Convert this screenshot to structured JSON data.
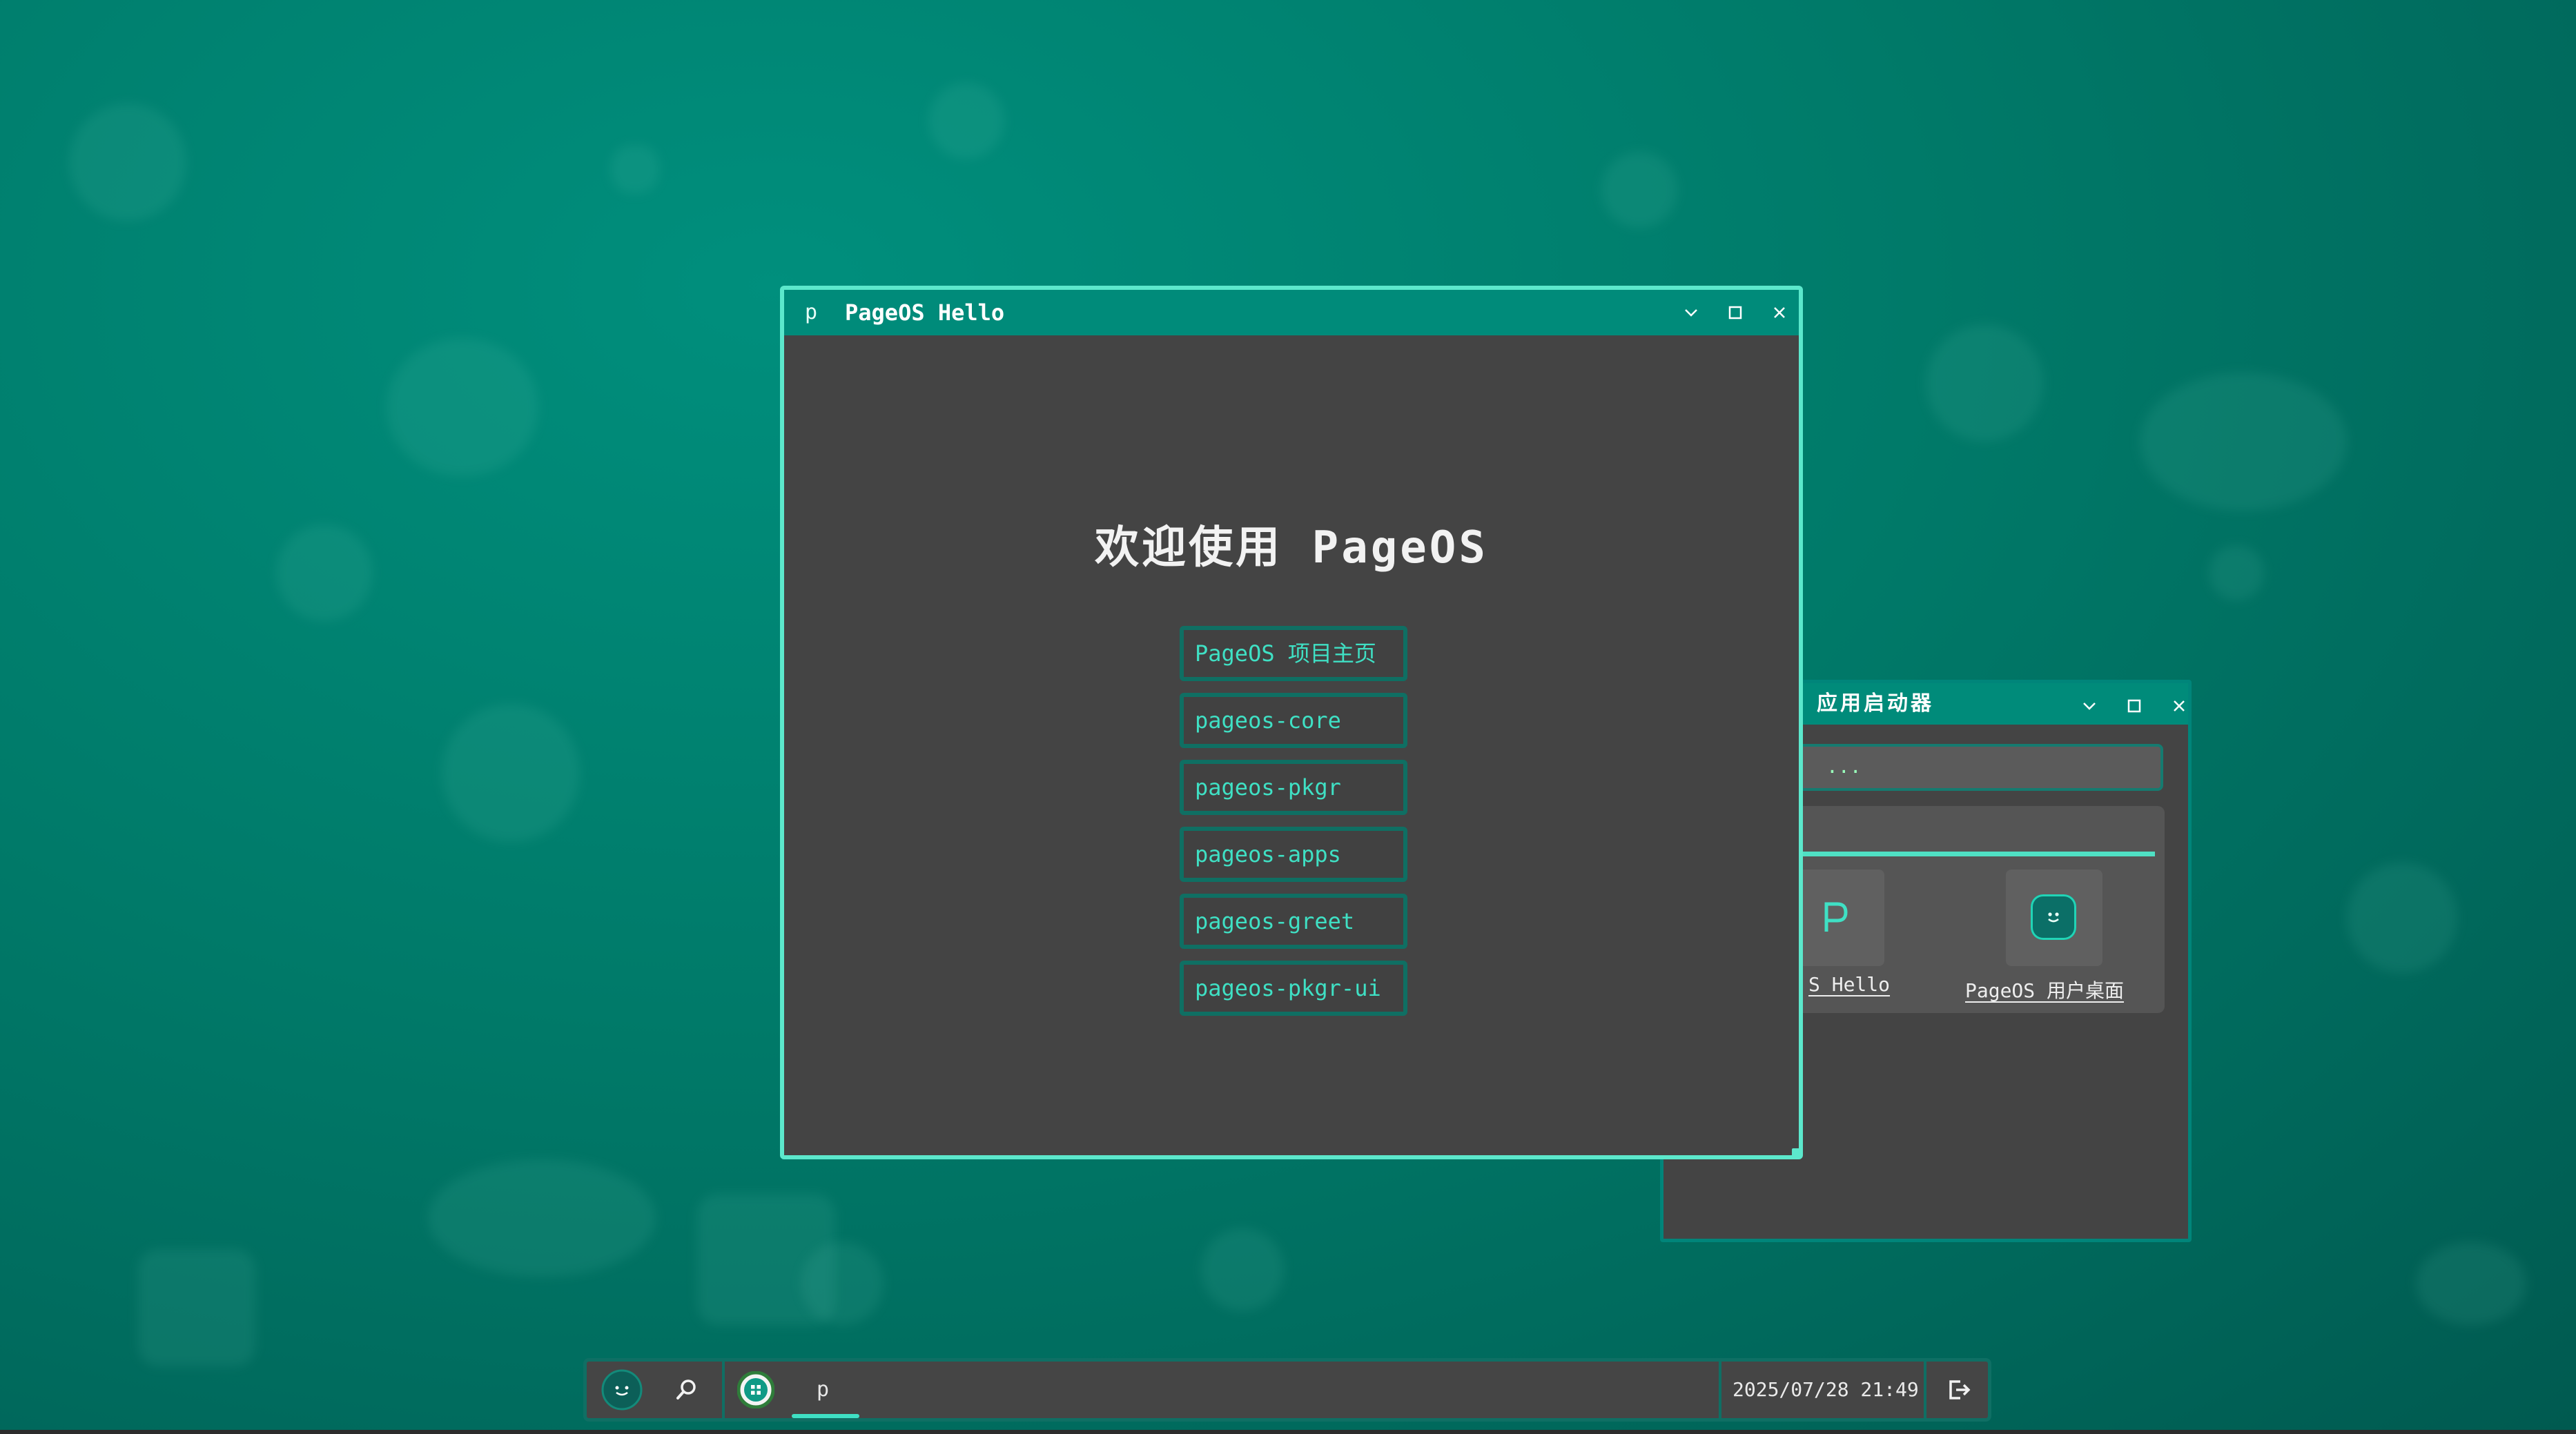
{
  "hello_window": {
    "app_letter": "p",
    "title": "PageOS Hello",
    "welcome": "欢迎使用 PageOS",
    "links": [
      {
        "label": "PageOS 项目主页"
      },
      {
        "label": "pageos-core"
      },
      {
        "label": "pageos-pkgr"
      },
      {
        "label": "pageos-apps"
      },
      {
        "label": "pageos-greet"
      },
      {
        "label": "pageos-pkgr-ui"
      }
    ]
  },
  "launcher_window": {
    "title": "应用启动器",
    "search_placeholder": "...",
    "apps": [
      {
        "label": "S Hello",
        "icon": "letter-p-icon"
      },
      {
        "label": "PageOS 用户桌面",
        "icon": "smiley-face-icon"
      }
    ]
  },
  "taskbar": {
    "task_label": "p",
    "clock": "2025/07/28 21:49"
  },
  "colors": {
    "accent": "#3fe0c4",
    "titlebar": "#008b7a",
    "window_bg": "#444444",
    "desktop": "#00846f"
  }
}
